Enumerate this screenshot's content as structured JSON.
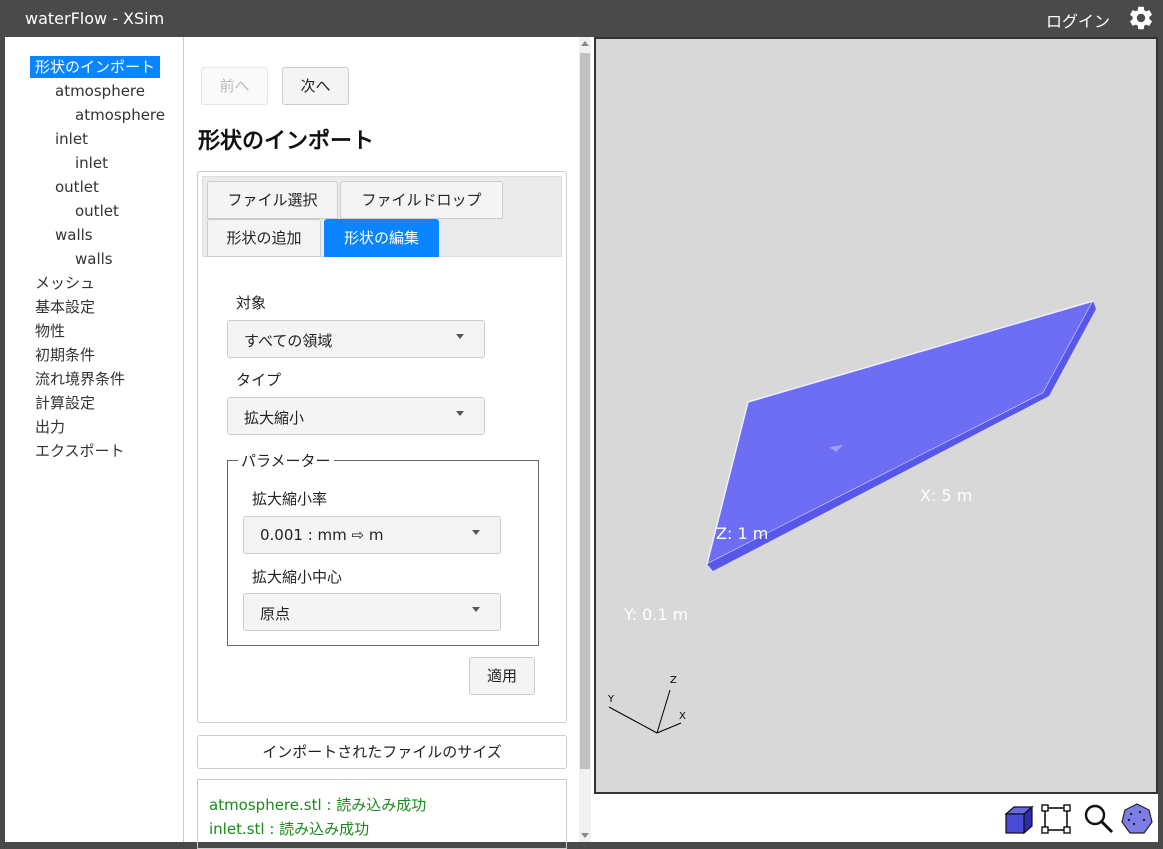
{
  "header": {
    "app_title": "waterFlow - XSim",
    "login_label": "ログイン",
    "settings_icon": "gear-icon"
  },
  "tree": {
    "items": [
      {
        "label": "形状のインポート",
        "level": 0,
        "active": true
      },
      {
        "label": "atmosphere",
        "level": 1
      },
      {
        "label": "atmosphere",
        "level": 2
      },
      {
        "label": "inlet",
        "level": 1
      },
      {
        "label": "inlet",
        "level": 2
      },
      {
        "label": "outlet",
        "level": 1
      },
      {
        "label": "outlet",
        "level": 2
      },
      {
        "label": "walls",
        "level": 1
      },
      {
        "label": "walls",
        "level": 2
      },
      {
        "label": "メッシュ",
        "level": 0
      },
      {
        "label": "基本設定",
        "level": 0
      },
      {
        "label": "物性",
        "level": 0
      },
      {
        "label": "初期条件",
        "level": 0
      },
      {
        "label": "流れ境界条件",
        "level": 0
      },
      {
        "label": "計算設定",
        "level": 0
      },
      {
        "label": "出力",
        "level": 0
      },
      {
        "label": "エクスポート",
        "level": 0
      }
    ]
  },
  "nav": {
    "prev_label": "前へ",
    "next_label": "次へ"
  },
  "page": {
    "title": "形状のインポート"
  },
  "tabs": [
    {
      "label": "ファイル選択"
    },
    {
      "label": "ファイルドロップ"
    },
    {
      "label": "形状の追加"
    },
    {
      "label": "形状の編集",
      "active": true
    }
  ],
  "form": {
    "target_label": "対象",
    "target_value": "すべての領域",
    "type_label": "タイプ",
    "type_value": "拡大縮小",
    "params_legend": "パラメーター",
    "scale_rate_label": "拡大縮小率",
    "scale_rate_value": "0.001 : mm ⇨ m",
    "scale_center_label": "拡大縮小中心",
    "scale_center_value": "原点",
    "apply_label": "適用"
  },
  "import_size": {
    "label": "インポートされたファイルのサイズ"
  },
  "log": [
    "atmosphere.stl : 読み込み成功",
    "inlet.stl : 読み込み成功"
  ],
  "viewport": {
    "x_dim": "X: 5 m",
    "y_dim": "Y: 0.1 m",
    "z_dim": "Z: 1 m",
    "axes": {
      "x": "X",
      "y": "Y",
      "z": "Z"
    },
    "shape_color": "#6e6ef5"
  },
  "toolbar": {
    "icons": [
      "cube-view-icon",
      "fit-bounds-icon",
      "zoom-icon",
      "polyhedron-icon"
    ]
  }
}
